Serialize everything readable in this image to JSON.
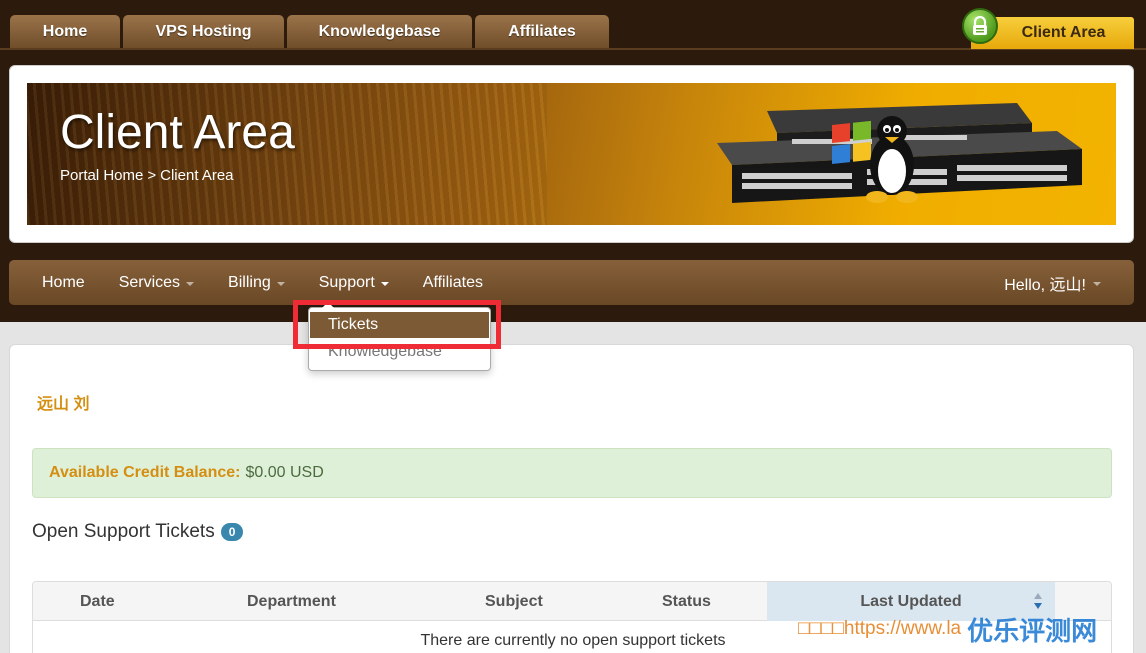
{
  "top_tabs": [
    "Home",
    "VPS Hosting",
    "Knowledgebase",
    "Affiliates"
  ],
  "client_area_tab": "Client Area",
  "banner": {
    "title": "Client Area",
    "breadcrumb": [
      "Portal Home",
      ">",
      "Client Area"
    ]
  },
  "nav": {
    "items": [
      "Home",
      "Services",
      "Billing",
      "Support",
      "Affiliates"
    ],
    "user_greeting": "Hello, 远山!"
  },
  "dropdown": {
    "items": [
      "Tickets",
      "Knowledgebase"
    ]
  },
  "content": {
    "user_name": "远山 刘",
    "credit_label": "Available Credit Balance:",
    "credit_value": "$0.00 USD",
    "tickets_heading": "Open Support Tickets",
    "tickets_count": "0",
    "table_headers": [
      "Date",
      "Department",
      "Subject",
      "Status",
      "Last Updated"
    ],
    "empty_message": "There are currently no open support tickets"
  },
  "watermark": {
    "text": "□□□□https://www.la",
    "logo": "优乐评测网"
  },
  "colors": {
    "highlight": "#ef2b36",
    "accent_orange": "#d48f12",
    "nav_brown": "#7b5a35"
  }
}
